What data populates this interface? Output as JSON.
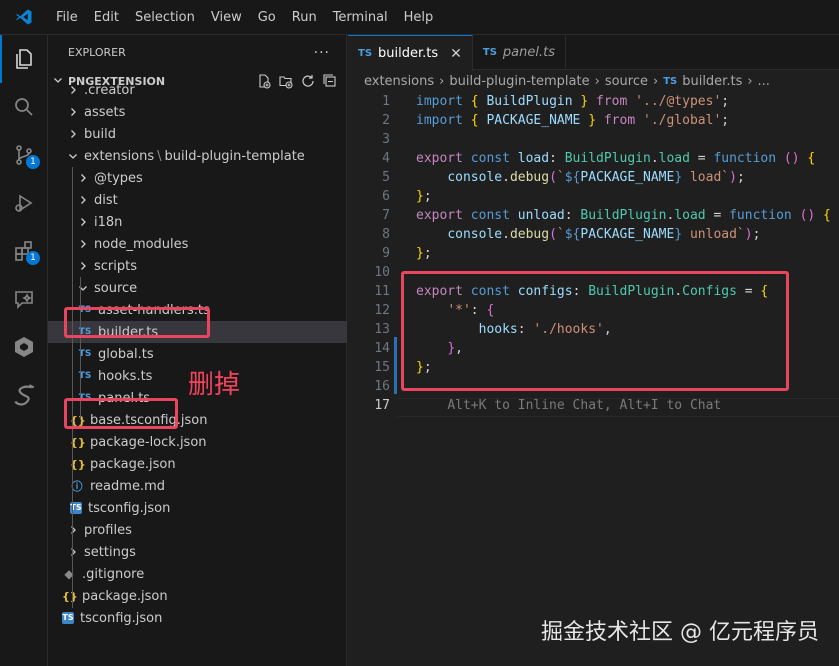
{
  "menu": [
    "File",
    "Edit",
    "Selection",
    "View",
    "Go",
    "Run",
    "Terminal",
    "Help"
  ],
  "activity": {
    "source_control_badge": "1",
    "extensions_badge": "1"
  },
  "explorer": {
    "title": "EXPLORER",
    "more": "···",
    "section": "PNGEXTENSION",
    "tree": [
      {
        "label": ".creator",
        "kind": "folder",
        "expanded": false
      },
      {
        "label": "assets",
        "kind": "folder",
        "expanded": false
      },
      {
        "label": "build",
        "kind": "folder",
        "expanded": false
      },
      {
        "label": "extensions",
        "label2": "build-plugin-template",
        "kind": "folder",
        "expanded": true
      },
      {
        "label": "@types",
        "kind": "folder",
        "expanded": false
      },
      {
        "label": "dist",
        "kind": "folder",
        "expanded": false
      },
      {
        "label": "i18n",
        "kind": "folder",
        "expanded": false
      },
      {
        "label": "node_modules",
        "kind": "folder",
        "expanded": false
      },
      {
        "label": "scripts",
        "kind": "folder",
        "expanded": false
      },
      {
        "label": "source",
        "kind": "folder",
        "expanded": true
      },
      {
        "label": "asset-handlers.ts",
        "kind": "ts",
        "icon": "TS"
      },
      {
        "label": "builder.ts",
        "kind": "ts",
        "icon": "TS",
        "selected": true
      },
      {
        "label": "global.ts",
        "kind": "ts",
        "icon": "TS"
      },
      {
        "label": "hooks.ts",
        "kind": "ts",
        "icon": "TS"
      },
      {
        "label": "panel.ts",
        "kind": "ts",
        "icon": "TS"
      },
      {
        "label": "base.tsconfig.json",
        "kind": "json",
        "icon": "{}"
      },
      {
        "label": "package-lock.json",
        "kind": "json",
        "icon": "{}"
      },
      {
        "label": "package.json",
        "kind": "json",
        "icon": "{}"
      },
      {
        "label": "readme.md",
        "kind": "info",
        "icon": "ⓘ"
      },
      {
        "label": "tsconfig.json",
        "kind": "tsconfig",
        "icon": "TS"
      },
      {
        "label": "profiles",
        "kind": "folder",
        "expanded": false
      },
      {
        "label": "settings",
        "kind": "folder",
        "expanded": false
      },
      {
        "label": ".gitignore",
        "kind": "git",
        "icon": "◆"
      },
      {
        "label": "package.json",
        "kind": "json",
        "icon": "{}"
      },
      {
        "label": "tsconfig.json",
        "kind": "tsconfig",
        "icon": "TS"
      }
    ],
    "annotation": "删掉"
  },
  "tabs": [
    {
      "icon": "TS",
      "label": "builder.ts",
      "active": true,
      "close": "✕"
    },
    {
      "icon": "TS",
      "label": "panel.ts",
      "active": false
    }
  ],
  "breadcrumb": [
    "extensions",
    "build-plugin-template",
    "source",
    "builder.ts",
    "..."
  ],
  "breadcrumb_icon": "TS",
  "code": [
    [
      [
        "k",
        "import"
      ],
      [
        "p",
        " "
      ],
      [
        "br1",
        "{"
      ],
      [
        "p",
        " "
      ],
      [
        "v",
        "BuildPlugin"
      ],
      [
        "p",
        " "
      ],
      [
        "br1",
        "}"
      ],
      [
        "p",
        " "
      ],
      [
        "kw",
        "from"
      ],
      [
        "p",
        " "
      ],
      [
        "s",
        "'../@types'"
      ],
      [
        "p",
        ";"
      ]
    ],
    [
      [
        "k",
        "import"
      ],
      [
        "p",
        " "
      ],
      [
        "br1",
        "{"
      ],
      [
        "p",
        " "
      ],
      [
        "v",
        "PACKAGE_NAME"
      ],
      [
        "p",
        " "
      ],
      [
        "br1",
        "}"
      ],
      [
        "p",
        " "
      ],
      [
        "kw",
        "from"
      ],
      [
        "p",
        " "
      ],
      [
        "s",
        "'./global'"
      ],
      [
        "p",
        ";"
      ]
    ],
    [],
    [
      [
        "kw",
        "export"
      ],
      [
        "p",
        " "
      ],
      [
        "k",
        "const"
      ],
      [
        "p",
        " "
      ],
      [
        "v",
        "load"
      ],
      [
        "p",
        ": "
      ],
      [
        "t",
        "BuildPlugin"
      ],
      [
        "p",
        "."
      ],
      [
        "t",
        "load"
      ],
      [
        "p",
        " = "
      ],
      [
        "k",
        "function"
      ],
      [
        "p",
        " "
      ],
      [
        "br2",
        "()"
      ],
      [
        "p",
        " "
      ],
      [
        "br1",
        "{"
      ]
    ],
    [
      [
        "p",
        "    "
      ],
      [
        "v",
        "console"
      ],
      [
        "p",
        "."
      ],
      [
        "f",
        "debug"
      ],
      [
        "br2",
        "("
      ],
      [
        "s",
        "`"
      ],
      [
        "k",
        "${"
      ],
      [
        "v",
        "PACKAGE_NAME"
      ],
      [
        "k",
        "}"
      ],
      [
        "s",
        " load`"
      ],
      [
        "br2",
        ")"
      ],
      [
        "p",
        ";"
      ]
    ],
    [
      [
        "br1",
        "}"
      ],
      [
        "p",
        ";"
      ]
    ],
    [
      [
        "kw",
        "export"
      ],
      [
        "p",
        " "
      ],
      [
        "k",
        "const"
      ],
      [
        "p",
        " "
      ],
      [
        "v",
        "unload"
      ],
      [
        "p",
        ": "
      ],
      [
        "t",
        "BuildPlugin"
      ],
      [
        "p",
        "."
      ],
      [
        "t",
        "load"
      ],
      [
        "p",
        " = "
      ],
      [
        "k",
        "function"
      ],
      [
        "p",
        " "
      ],
      [
        "br2",
        "()"
      ],
      [
        "p",
        " "
      ],
      [
        "br1",
        "{"
      ]
    ],
    [
      [
        "p",
        "    "
      ],
      [
        "v",
        "console"
      ],
      [
        "p",
        "."
      ],
      [
        "f",
        "debug"
      ],
      [
        "br2",
        "("
      ],
      [
        "s",
        "`"
      ],
      [
        "k",
        "${"
      ],
      [
        "v",
        "PACKAGE_NAME"
      ],
      [
        "k",
        "}"
      ],
      [
        "s",
        " unload`"
      ],
      [
        "br2",
        ")"
      ],
      [
        "p",
        ";"
      ]
    ],
    [
      [
        "br1",
        "}"
      ],
      [
        "p",
        ";"
      ]
    ],
    [],
    [
      [
        "kw",
        "export"
      ],
      [
        "p",
        " "
      ],
      [
        "k",
        "const"
      ],
      [
        "p",
        " "
      ],
      [
        "v",
        "configs"
      ],
      [
        "p",
        ": "
      ],
      [
        "t",
        "BuildPlugin"
      ],
      [
        "p",
        "."
      ],
      [
        "t",
        "Configs"
      ],
      [
        "p",
        " = "
      ],
      [
        "br1",
        "{"
      ]
    ],
    [
      [
        "p",
        "    "
      ],
      [
        "s",
        "'*'"
      ],
      [
        "p",
        ": "
      ],
      [
        "br2",
        "{"
      ]
    ],
    [
      [
        "p",
        "        "
      ],
      [
        "v",
        "hooks"
      ],
      [
        "p",
        ": "
      ],
      [
        "s",
        "'./hooks'"
      ],
      [
        "p",
        ","
      ]
    ],
    [
      [
        "p",
        "    "
      ],
      [
        "br2",
        "}"
      ],
      [
        "p",
        ","
      ]
    ],
    [
      [
        "br1",
        "}"
      ],
      [
        "p",
        ";"
      ]
    ],
    [],
    [
      [
        "p",
        "    "
      ],
      [
        "ghost",
        "Alt+K to Inline Chat, Alt+I to Chat"
      ]
    ]
  ],
  "watermark": "掘金技术社区 @ 亿元程序员",
  "colors": {
    "accent": "#0078d4",
    "highlight": "#e8455e"
  }
}
